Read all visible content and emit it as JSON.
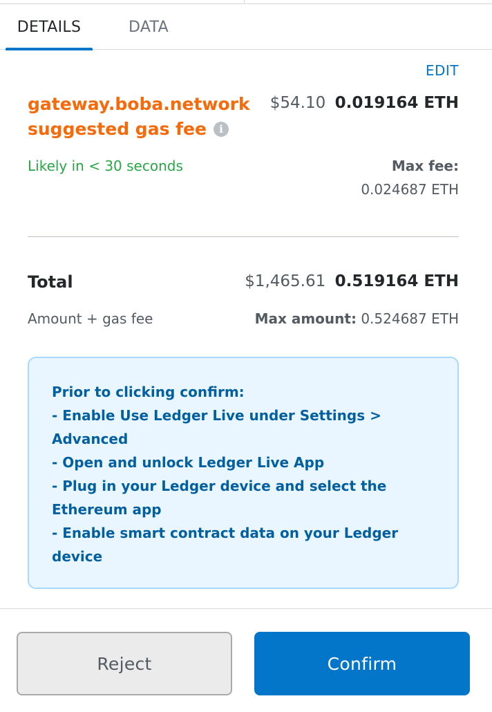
{
  "tabs": [
    {
      "label": "DETAILS",
      "active": true
    },
    {
      "label": "DATA",
      "active": false
    }
  ],
  "gas": {
    "edit_label": "EDIT",
    "site_line1": "gateway.boba.network",
    "site_line2": "suggested gas fee",
    "info_icon": "info-icon",
    "fee_usd": "$54.10",
    "fee_eth": "0.019164 ETH",
    "likely": "Likely in < 30 seconds",
    "max_fee_label": "Max fee:",
    "max_fee_value": "0.024687 ETH"
  },
  "total": {
    "label": "Total",
    "usd": "$1,465.61",
    "eth": "0.519164 ETH",
    "sub_label": "Amount + gas fee",
    "max_amount_label": "Max amount:",
    "max_amount_value": "0.524687 ETH"
  },
  "notice": {
    "lines": [
      "Prior to clicking confirm:",
      "- Enable Use Ledger Live under Settings > Advanced",
      "- Open and unlock Ledger Live App",
      "- Plug in your Ledger device and select the Ethereum app",
      "- Enable smart contract data on your Ledger device"
    ]
  },
  "footer": {
    "reject_label": "Reject",
    "confirm_label": "Confirm"
  },
  "colors": {
    "accent": "#0376c9",
    "site_orange": "#f66a0a",
    "likely_green": "#28a745",
    "notice_bg": "#eaf6ff",
    "notice_text": "#0360a0"
  }
}
